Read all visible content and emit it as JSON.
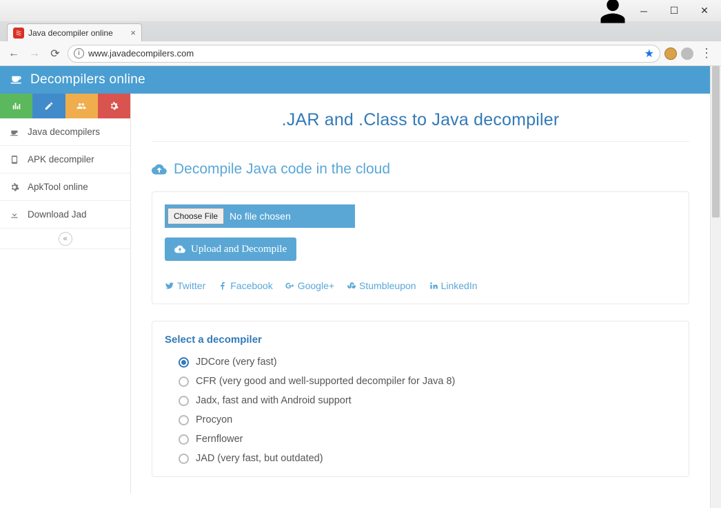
{
  "window": {
    "tab_title": "Java decompiler online",
    "url": "www.javadecompilers.com"
  },
  "site": {
    "title": "Decompilers online"
  },
  "sidebar": {
    "items": [
      {
        "label": "Java decompilers"
      },
      {
        "label": "APK decompiler"
      },
      {
        "label": "ApkTool online"
      },
      {
        "label": "Download Jad"
      }
    ]
  },
  "main": {
    "page_title": ".JAR and .Class to Java decompiler",
    "sub_heading": "Decompile Java code in the cloud",
    "choose_file_label": "Choose File",
    "no_file_label": "No file chosen",
    "upload_label": "Upload and Decompile",
    "socials": [
      {
        "label": "Twitter"
      },
      {
        "label": "Facebook"
      },
      {
        "label": "Google+"
      },
      {
        "label": "Stumbleupon"
      },
      {
        "label": "LinkedIn"
      }
    ],
    "select_heading": "Select a decompiler",
    "decompilers": [
      {
        "label": "JDCore (very fast)",
        "selected": true
      },
      {
        "label": "CFR (very good and well-supported decompiler for Java 8)",
        "selected": false
      },
      {
        "label": "Jadx, fast and with Android support",
        "selected": false
      },
      {
        "label": "Procyon",
        "selected": false
      },
      {
        "label": "Fernflower",
        "selected": false
      },
      {
        "label": "JAD (very fast, but outdated)",
        "selected": false
      }
    ]
  }
}
